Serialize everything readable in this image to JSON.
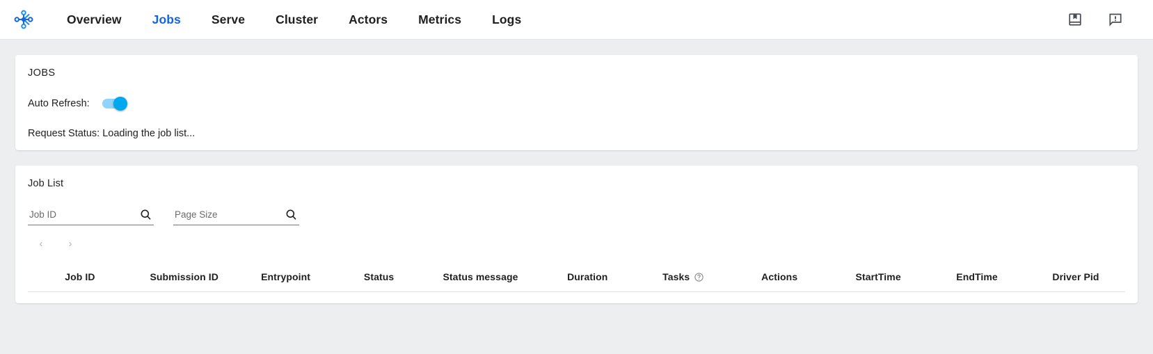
{
  "navbar": {
    "logo_name": "ray-logo",
    "links": [
      {
        "label": "Overview",
        "active": false
      },
      {
        "label": "Jobs",
        "active": true
      },
      {
        "label": "Serve",
        "active": false
      },
      {
        "label": "Cluster",
        "active": false
      },
      {
        "label": "Actors",
        "active": false
      },
      {
        "label": "Metrics",
        "active": false
      },
      {
        "label": "Logs",
        "active": false
      }
    ],
    "actions": [
      {
        "name": "documentation-icon",
        "title": "Docs"
      },
      {
        "name": "feedback-icon",
        "title": "Feedback"
      }
    ],
    "active_color": "#1565e0"
  },
  "jobs_card": {
    "title": "JOBS",
    "auto_refresh_label": "Auto Refresh:",
    "auto_refresh_on": true,
    "toggle_track_color": "#8fd4fb",
    "toggle_thumb_color": "#00a8f0",
    "request_status": "Request Status: Loading the job list..."
  },
  "job_list_card": {
    "title": "Job List",
    "filters": [
      {
        "name": "job-id-input",
        "placeholder": "Job ID",
        "value": ""
      },
      {
        "name": "page-size-input",
        "placeholder": "Page Size",
        "value": ""
      }
    ],
    "pagination": {
      "prev_label": "‹",
      "next_label": "›"
    },
    "columns": [
      {
        "label": "Job ID",
        "help": false
      },
      {
        "label": "Submission ID",
        "help": false
      },
      {
        "label": "Entrypoint",
        "help": false
      },
      {
        "label": "Status",
        "help": false
      },
      {
        "label": "Status message",
        "help": false
      },
      {
        "label": "Duration",
        "help": false
      },
      {
        "label": "Tasks",
        "help": true
      },
      {
        "label": "Actions",
        "help": false
      },
      {
        "label": "StartTime",
        "help": false
      },
      {
        "label": "EndTime",
        "help": false
      },
      {
        "label": "Driver Pid",
        "help": false
      }
    ],
    "rows": []
  }
}
